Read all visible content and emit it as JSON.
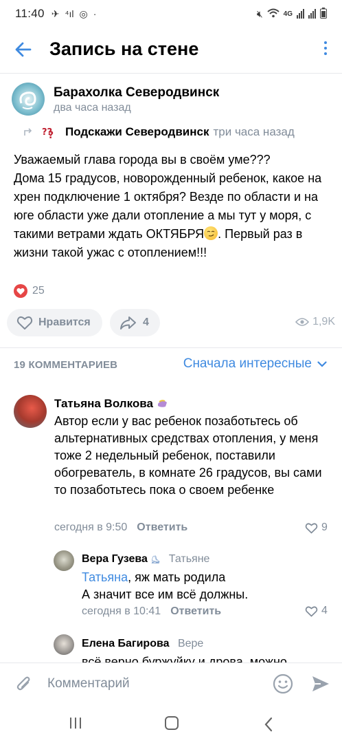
{
  "status_bar": {
    "time": "11:40",
    "network": "4G"
  },
  "header": {
    "title": "Запись на стене"
  },
  "post": {
    "group_name": "Барахолка Северодвинск",
    "time": "два часа назад",
    "repost_source": "Подскажи Северодвинск",
    "repost_time": "три часа назад",
    "text_before_emoji": "Уважаемый глава города вы в своём уме???\nДома 15 градусов, новорожденный ребенок, какое на хрен подключение 1 октября? Везде по области и на юге области уже дали отопление а мы тут у моря, с такими ветрами ждать ОКТЯБРЯ",
    "text_after_emoji": ". Первый раз в жизни такой ужас с отоплением!!!",
    "reactions_count": "25",
    "like_label": "Нравится",
    "share_count": "4",
    "views": "1,9K"
  },
  "comments_header": {
    "count_label": "19 КОММЕНТАРИЕВ",
    "sort_label": "Сначала интересные"
  },
  "comments": [
    {
      "author": "Татьяна Волкова",
      "text": "Автор если у вас ребенок позаботьтесь об альтернативных средствах отопления, у меня тоже 2 недельный ребенок, поставили обогреватель, в комнате 26 градусов, вы сами то позаботьтесь пока о своем ребенке",
      "time": "сегодня в 9:50",
      "reply_label": "Ответить",
      "likes": "9"
    },
    {
      "author": "Вера Гузева",
      "reply_to": "Татьяне",
      "mention": "Татьяна",
      "text_after_mention": ", яж мать родила",
      "text_line2": "А значит все им всё должны.",
      "time": "сегодня в 10:41",
      "reply_label": "Ответить",
      "likes": "4"
    },
    {
      "author": "Елена Багирова",
      "reply_to": "Вере",
      "text": "всё верно буржуйку и дрова, можно"
    }
  ],
  "composer": {
    "placeholder": "Комментарий"
  },
  "colors": {
    "accent": "#3f8ae0",
    "secondary_text": "#818c99",
    "like_red": "#e64646",
    "pill_bg": "#f2f3f5"
  }
}
